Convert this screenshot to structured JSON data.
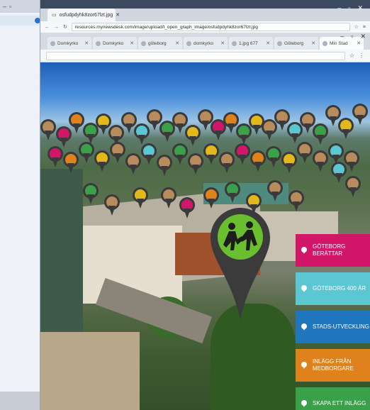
{
  "window_top": {
    "tab_title": "osfudpdyhk8zor67lzt.jpg",
    "url": "resources.mynewsdesk.com/image/upload/t_open_graph_image/osfudpdyhk8zor67lzt.jpg"
  },
  "window_main": {
    "tabs": [
      {
        "label": "Domkyrko"
      },
      {
        "label": "Domkyrko"
      },
      {
        "label": "göteborg"
      },
      {
        "label": "domkyrko"
      },
      {
        "label": "1.jpg 677"
      },
      {
        "label": "Göteborg"
      },
      {
        "label": "Min Stad"
      }
    ]
  },
  "panel": {
    "buttons": [
      {
        "label": "GÖTEBORG BERÄTTAR",
        "color": "#d2176a"
      },
      {
        "label": "GÖTEBORG 400 ÅR",
        "color": "#5bc7d3"
      },
      {
        "label": "STADS-UTVECKLING",
        "color": "#1f76bd"
      },
      {
        "label": "INLÄGG FRÅN MEDBORGARE",
        "color": "#e0821c"
      },
      {
        "label": "SKAPA ETT INLÄGG",
        "color": "#3aa14a"
      }
    ]
  },
  "big_pin": {
    "icon": "people-icon",
    "color": "#6abf2e"
  }
}
